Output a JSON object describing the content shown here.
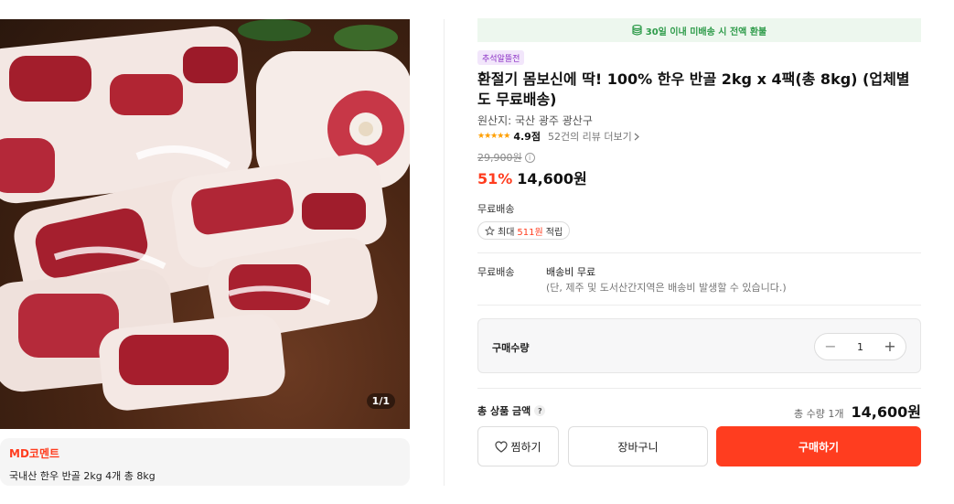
{
  "image": {
    "counter": "1/1"
  },
  "md_comment": {
    "title": "MD코멘트",
    "text": "국내산 한우 반골 2kg 4개 총 8kg"
  },
  "banner": {
    "text": "30일 이내 미배송 시 전액 환불",
    "icon": "coin-stack-icon",
    "color": "#2e9b4a"
  },
  "product": {
    "event_tag": "추석알뜰전",
    "title": "환절기 몸보신에 딱! 100% 한우 반골 2kg x 4팩(총 8kg) (업체별도 무료배송)",
    "origin": "원산지: 국산 광주 광산구",
    "rating": {
      "stars": "★★★★★",
      "score": "4.9점",
      "reviews": "52건의 리뷰 더보기",
      "value": 4.9
    },
    "original_price": "29,900원",
    "discount": "51%",
    "sale_price": "14,600원"
  },
  "delivery": {
    "free_label": "무료배송",
    "points_prefix": "최대",
    "points_value": "511원",
    "points_suffix": "적립",
    "ship_label": "무료배송",
    "ship_fee": "배송비 무료",
    "ship_note": "(단, 제주 및 도서산간지역은 배송비 발생할 수 있습니다.)"
  },
  "quantity": {
    "label": "구매수량",
    "minus": "−",
    "plus": "+",
    "value": "1"
  },
  "total": {
    "label": "총 상품 금액",
    "help": "?",
    "count": "총 수량 1개",
    "price": "14,600원"
  },
  "buttons": {
    "wish": "찜하기",
    "cart": "장바구니",
    "buy": "구매하기"
  },
  "colors": {
    "accent": "#ff3d1f",
    "star": "#ff9f00"
  }
}
